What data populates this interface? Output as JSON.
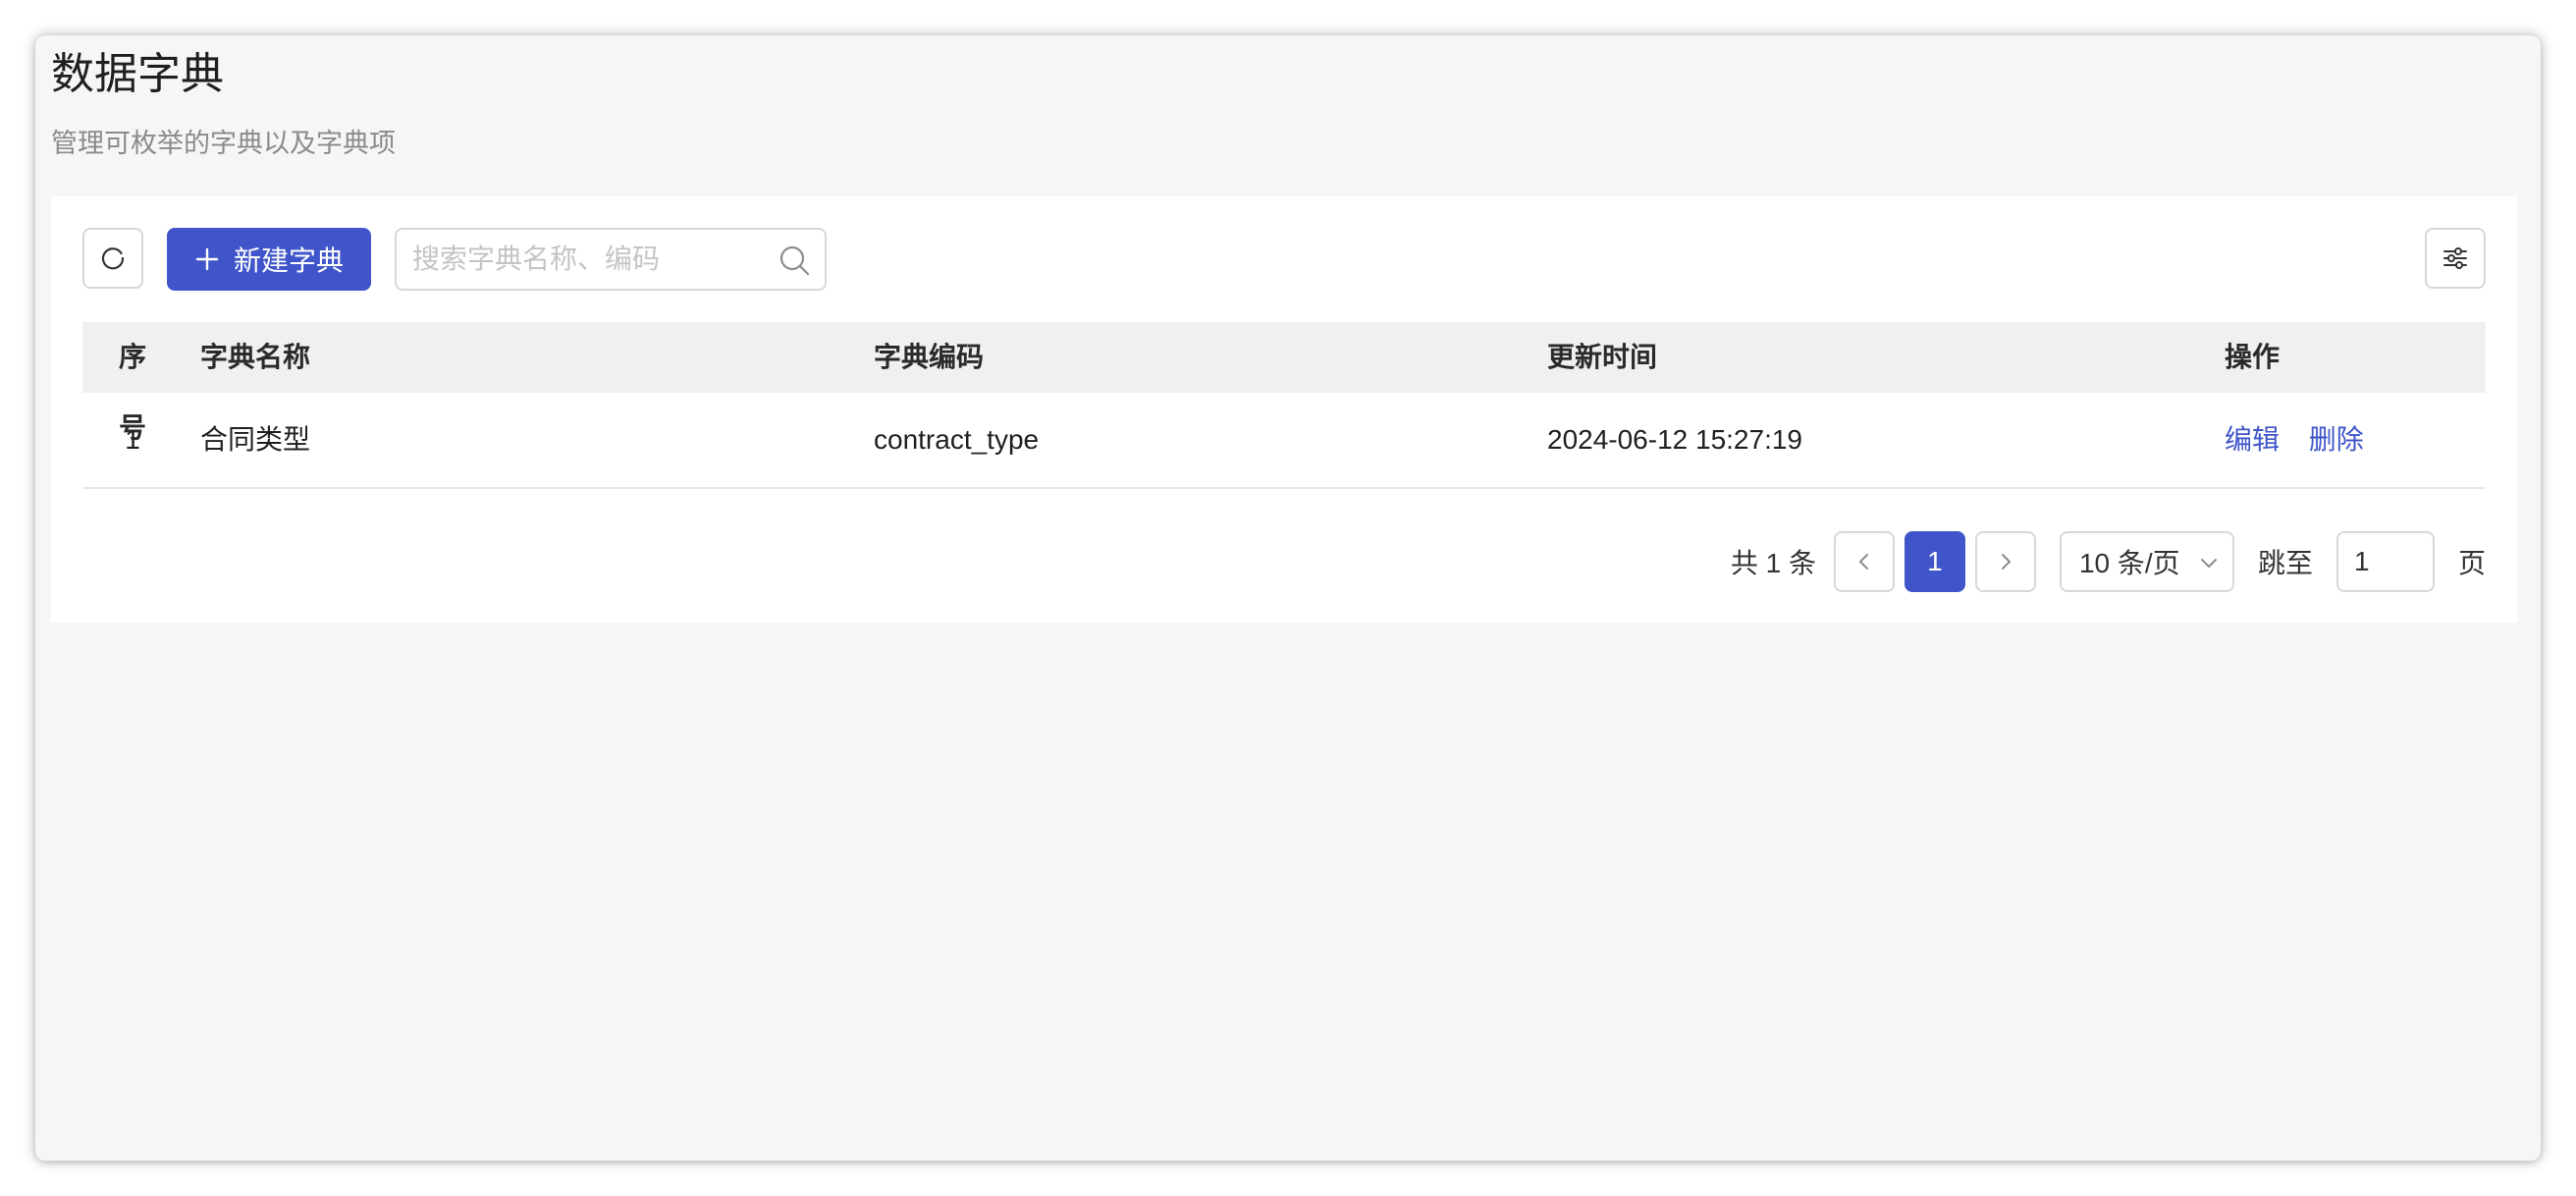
{
  "page": {
    "title": "数据字典",
    "subtitle": "管理可枚举的字典以及字典项"
  },
  "toolbar": {
    "refresh_icon": "refresh-icon",
    "create_label": "新建字典",
    "search_placeholder": "搜索字典名称、编码",
    "search_value": "",
    "settings_icon": "sliders-icon"
  },
  "table": {
    "columns": [
      "序号",
      "字典名称",
      "字典编码",
      "更新时间",
      "操作"
    ],
    "rows": [
      {
        "index": "1",
        "name": "合同类型",
        "code": "contract_type",
        "updated": "2024-06-12 15:27:19",
        "actions": [
          "编辑",
          "删除"
        ]
      }
    ]
  },
  "pagination": {
    "total_label": "共 1 条",
    "current_page": "1",
    "page_size": "10 条/页",
    "jump_label": "跳至",
    "jump_value": "1",
    "page_label": "页"
  },
  "colors": {
    "primary": "#3f55c9",
    "background": "#f6f6f6",
    "header_bg": "#f0f0f0"
  }
}
